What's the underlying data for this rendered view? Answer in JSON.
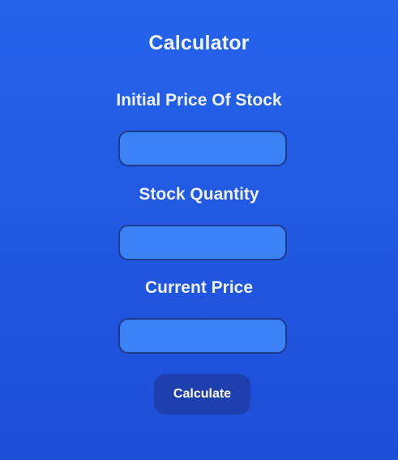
{
  "header": {
    "title": "Calculator"
  },
  "form": {
    "fields": [
      {
        "label": "Initial Price Of Stock",
        "value": "",
        "placeholder": ""
      },
      {
        "label": "Stock Quantity",
        "value": "",
        "placeholder": ""
      },
      {
        "label": "Current Price",
        "value": "",
        "placeholder": ""
      }
    ],
    "submit_label": "Calculate"
  },
  "colors": {
    "background_top": "#2563eb",
    "background_bottom": "#1d4ed8",
    "input_fill": "#3b82f6",
    "input_border": "#1e3a8a",
    "button_fill": "#1e40af",
    "text": "#ffffff"
  }
}
